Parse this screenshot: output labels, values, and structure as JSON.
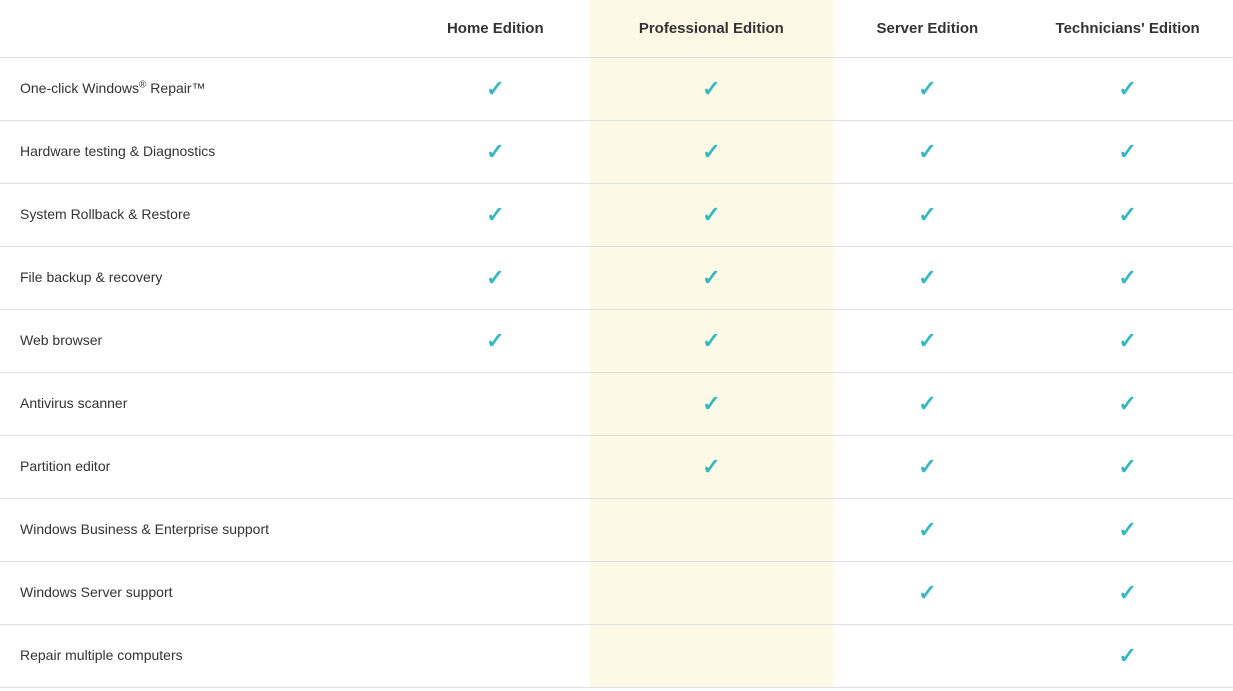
{
  "table": {
    "columns": [
      {
        "id": "feature",
        "label": ""
      },
      {
        "id": "home",
        "label": "Home Edition"
      },
      {
        "id": "professional",
        "label": "Professional Edition"
      },
      {
        "id": "server",
        "label": "Server Edition"
      },
      {
        "id": "technicians",
        "label": "Technicians' Edition"
      }
    ],
    "rows": [
      {
        "feature": "One-click Windows® Repair™",
        "feature_raw": "One-click Windows<sup>®</sup> Repair™",
        "home": true,
        "professional": true,
        "server": true,
        "technicians": true
      },
      {
        "feature": "Hardware testing & Diagnostics",
        "home": true,
        "professional": true,
        "server": true,
        "technicians": true
      },
      {
        "feature": "System Rollback & Restore",
        "home": true,
        "professional": true,
        "server": true,
        "technicians": true
      },
      {
        "feature": "File backup & recovery",
        "home": true,
        "professional": true,
        "server": true,
        "technicians": true
      },
      {
        "feature": "Web browser",
        "home": true,
        "professional": true,
        "server": true,
        "technicians": true
      },
      {
        "feature": "Antivirus scanner",
        "home": false,
        "professional": true,
        "server": true,
        "technicians": true
      },
      {
        "feature": "Partition editor",
        "home": false,
        "professional": true,
        "server": true,
        "technicians": true
      },
      {
        "feature": "Windows Business & Enterprise support",
        "home": false,
        "professional": false,
        "server": true,
        "technicians": true
      },
      {
        "feature": "Windows Server support",
        "home": false,
        "professional": false,
        "server": true,
        "technicians": true
      },
      {
        "feature": "Repair multiple computers",
        "home": false,
        "professional": false,
        "server": false,
        "technicians": true
      }
    ],
    "checkmark": "✓"
  }
}
